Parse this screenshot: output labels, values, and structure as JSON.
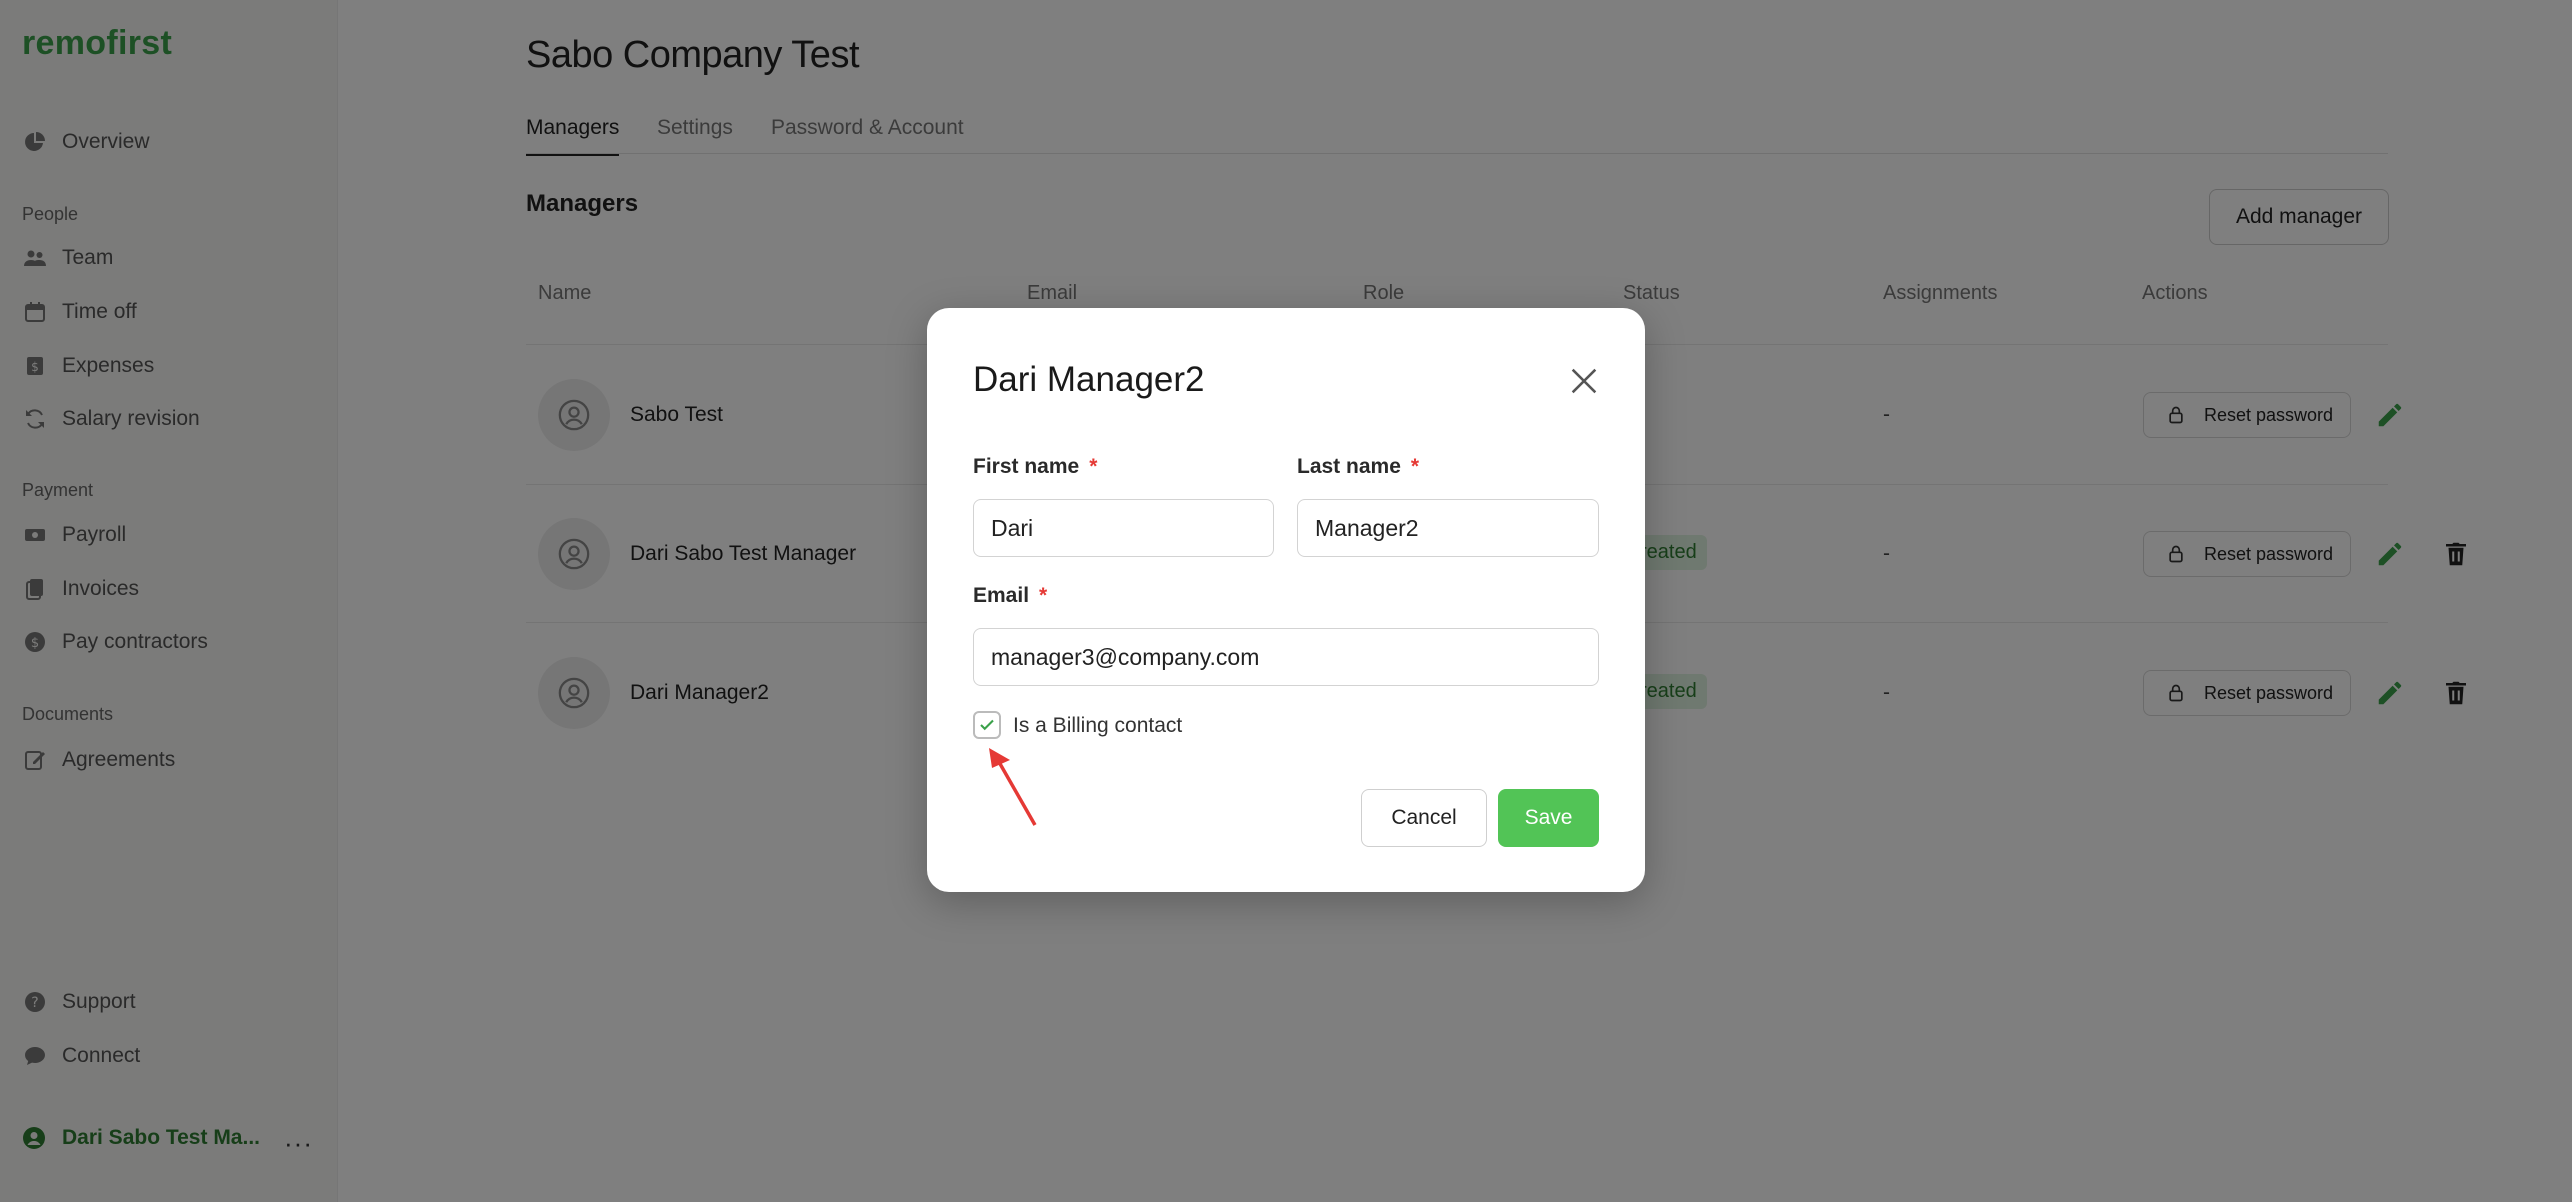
{
  "app": {
    "logo": "remofirst"
  },
  "sidebar": {
    "overview": "Overview",
    "section_people": "People",
    "team": "Team",
    "time_off": "Time off",
    "expenses": "Expenses",
    "salary_revision": "Salary revision",
    "section_payment": "Payment",
    "payroll": "Payroll",
    "invoices": "Invoices",
    "pay_contractors": "Pay contractors",
    "section_documents": "Documents",
    "agreements": "Agreements",
    "support": "Support",
    "connect": "Connect",
    "user_name": "Dari Sabo Test Ma...",
    "more": "···"
  },
  "page": {
    "title": "Sabo Company Test",
    "tabs": [
      "Managers",
      "Settings",
      "Password & Account"
    ],
    "section_title": "Managers",
    "add_button": "Add manager"
  },
  "table": {
    "headers": [
      "Name",
      "Email",
      "Role",
      "Status",
      "Assignments",
      "Actions"
    ],
    "rows": [
      {
        "name": "Sabo Test",
        "status": "",
        "assignments": "-",
        "reset": "Reset password"
      },
      {
        "name": "Dari Sabo Test Manager",
        "status": "reated",
        "assignments": "-",
        "reset": "Reset password"
      },
      {
        "name": "Dari Manager2",
        "status": "reated",
        "assignments": "-",
        "reset": "Reset password"
      }
    ]
  },
  "modal": {
    "title": "Dari Manager2",
    "first_name_label": "First name",
    "last_name_label": "Last name",
    "email_label": "Email",
    "required_mark": "*",
    "first_name_value": "Dari",
    "last_name_value": "Manager2",
    "email_value": "manager3@company.com",
    "billing_label": "Is a Billing contact",
    "billing_checked": true,
    "cancel": "Cancel",
    "save": "Save"
  },
  "colors": {
    "brand": "#3aa14a",
    "save": "#52c456",
    "required": "#e53935",
    "annotation_arrow": "#e53935"
  }
}
